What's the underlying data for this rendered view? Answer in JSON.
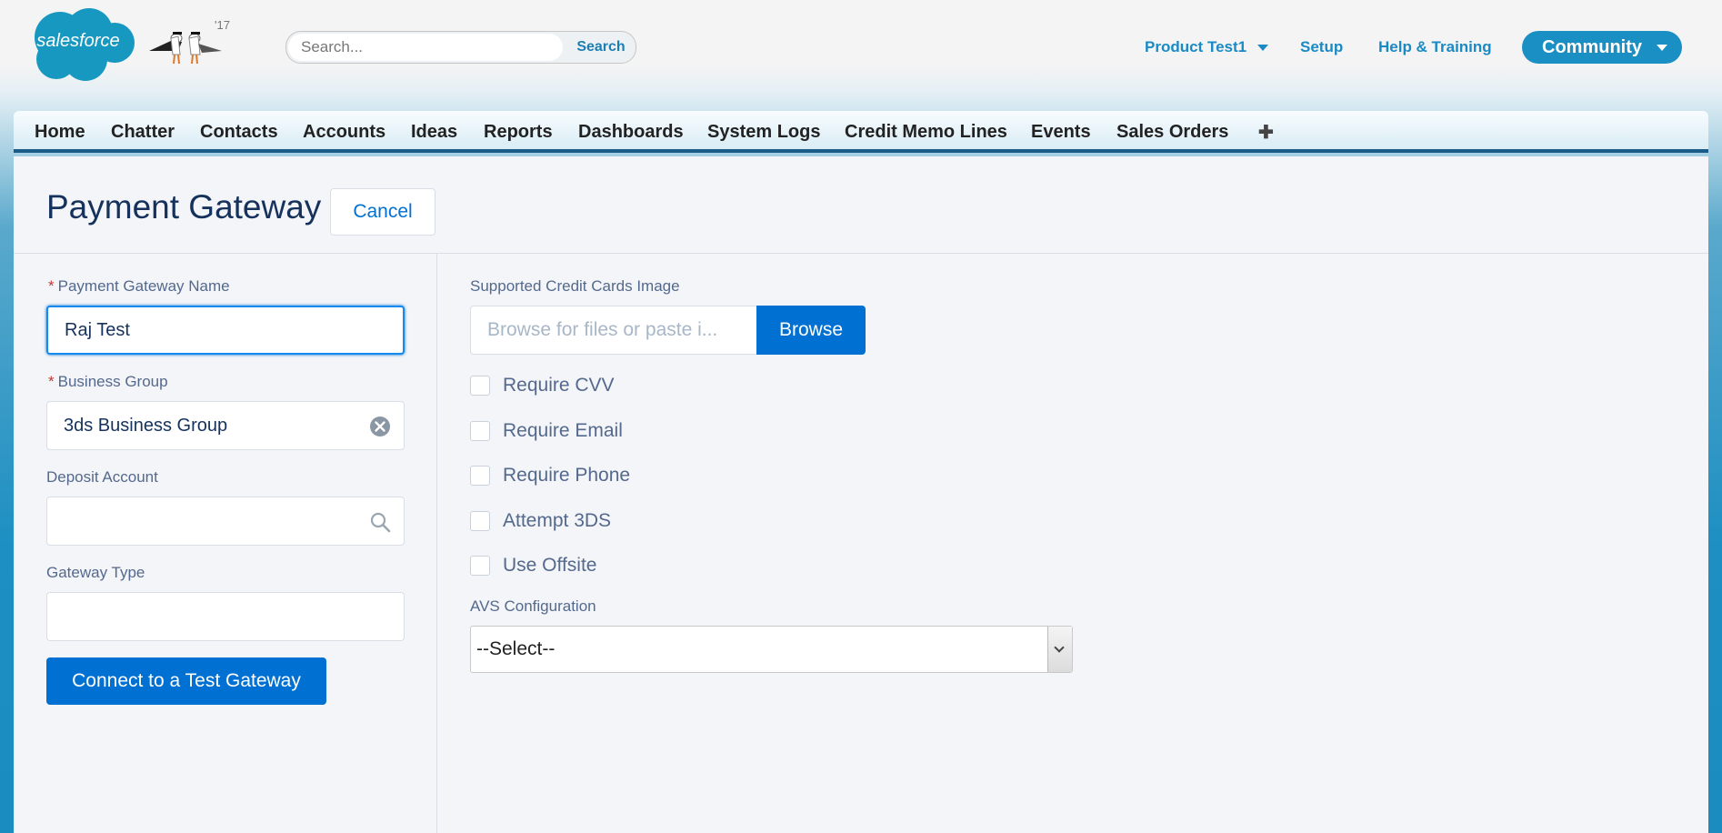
{
  "header": {
    "brand": "salesforce",
    "mascot_year": "'17",
    "search": {
      "placeholder": "Search...",
      "value": "",
      "button_label": "Search"
    },
    "user_menu": "Product Test1",
    "setup": "Setup",
    "help": "Help & Training",
    "app_switcher": "Community"
  },
  "tabs": [
    {
      "label": "Home"
    },
    {
      "label": "Chatter"
    },
    {
      "label": "Contacts"
    },
    {
      "label": "Accounts"
    },
    {
      "label": "Ideas"
    },
    {
      "label": "Reports"
    },
    {
      "label": "Dashboards"
    },
    {
      "label": "System Logs"
    },
    {
      "label": "Credit Memo Lines"
    },
    {
      "label": "Events"
    },
    {
      "label": "Sales Orders"
    }
  ],
  "tab_more_icon": "plus-icon",
  "page": {
    "title": "Payment Gateway",
    "cancel_label": "Cancel"
  },
  "form": {
    "required_marker": "*",
    "gateway_name": {
      "label": "Payment Gateway Name",
      "value": "Raj Test"
    },
    "business_group": {
      "label": "Business Group",
      "value": "3ds Business Group"
    },
    "deposit_account": {
      "label": "Deposit Account",
      "value": ""
    },
    "gateway_type": {
      "label": "Gateway Type",
      "value": ""
    },
    "connect_label": "Connect to a Test Gateway",
    "cards_image": {
      "label": "Supported Credit Cards Image",
      "placeholder": "Browse for files or paste i...",
      "browse_label": "Browse"
    },
    "checkboxes": [
      {
        "label": "Require CVV",
        "checked": false
      },
      {
        "label": "Require Email",
        "checked": false
      },
      {
        "label": "Require Phone",
        "checked": false
      },
      {
        "label": "Attempt 3DS",
        "checked": false
      },
      {
        "label": "Use Offsite",
        "checked": false
      }
    ],
    "avs": {
      "label": "AVS Configuration",
      "selected": "--Select--"
    }
  },
  "colors": {
    "brand_blue": "#0070d2",
    "header_link": "#1a8ac5",
    "community_bg": "#1a8fc3",
    "required": "#c23934"
  }
}
